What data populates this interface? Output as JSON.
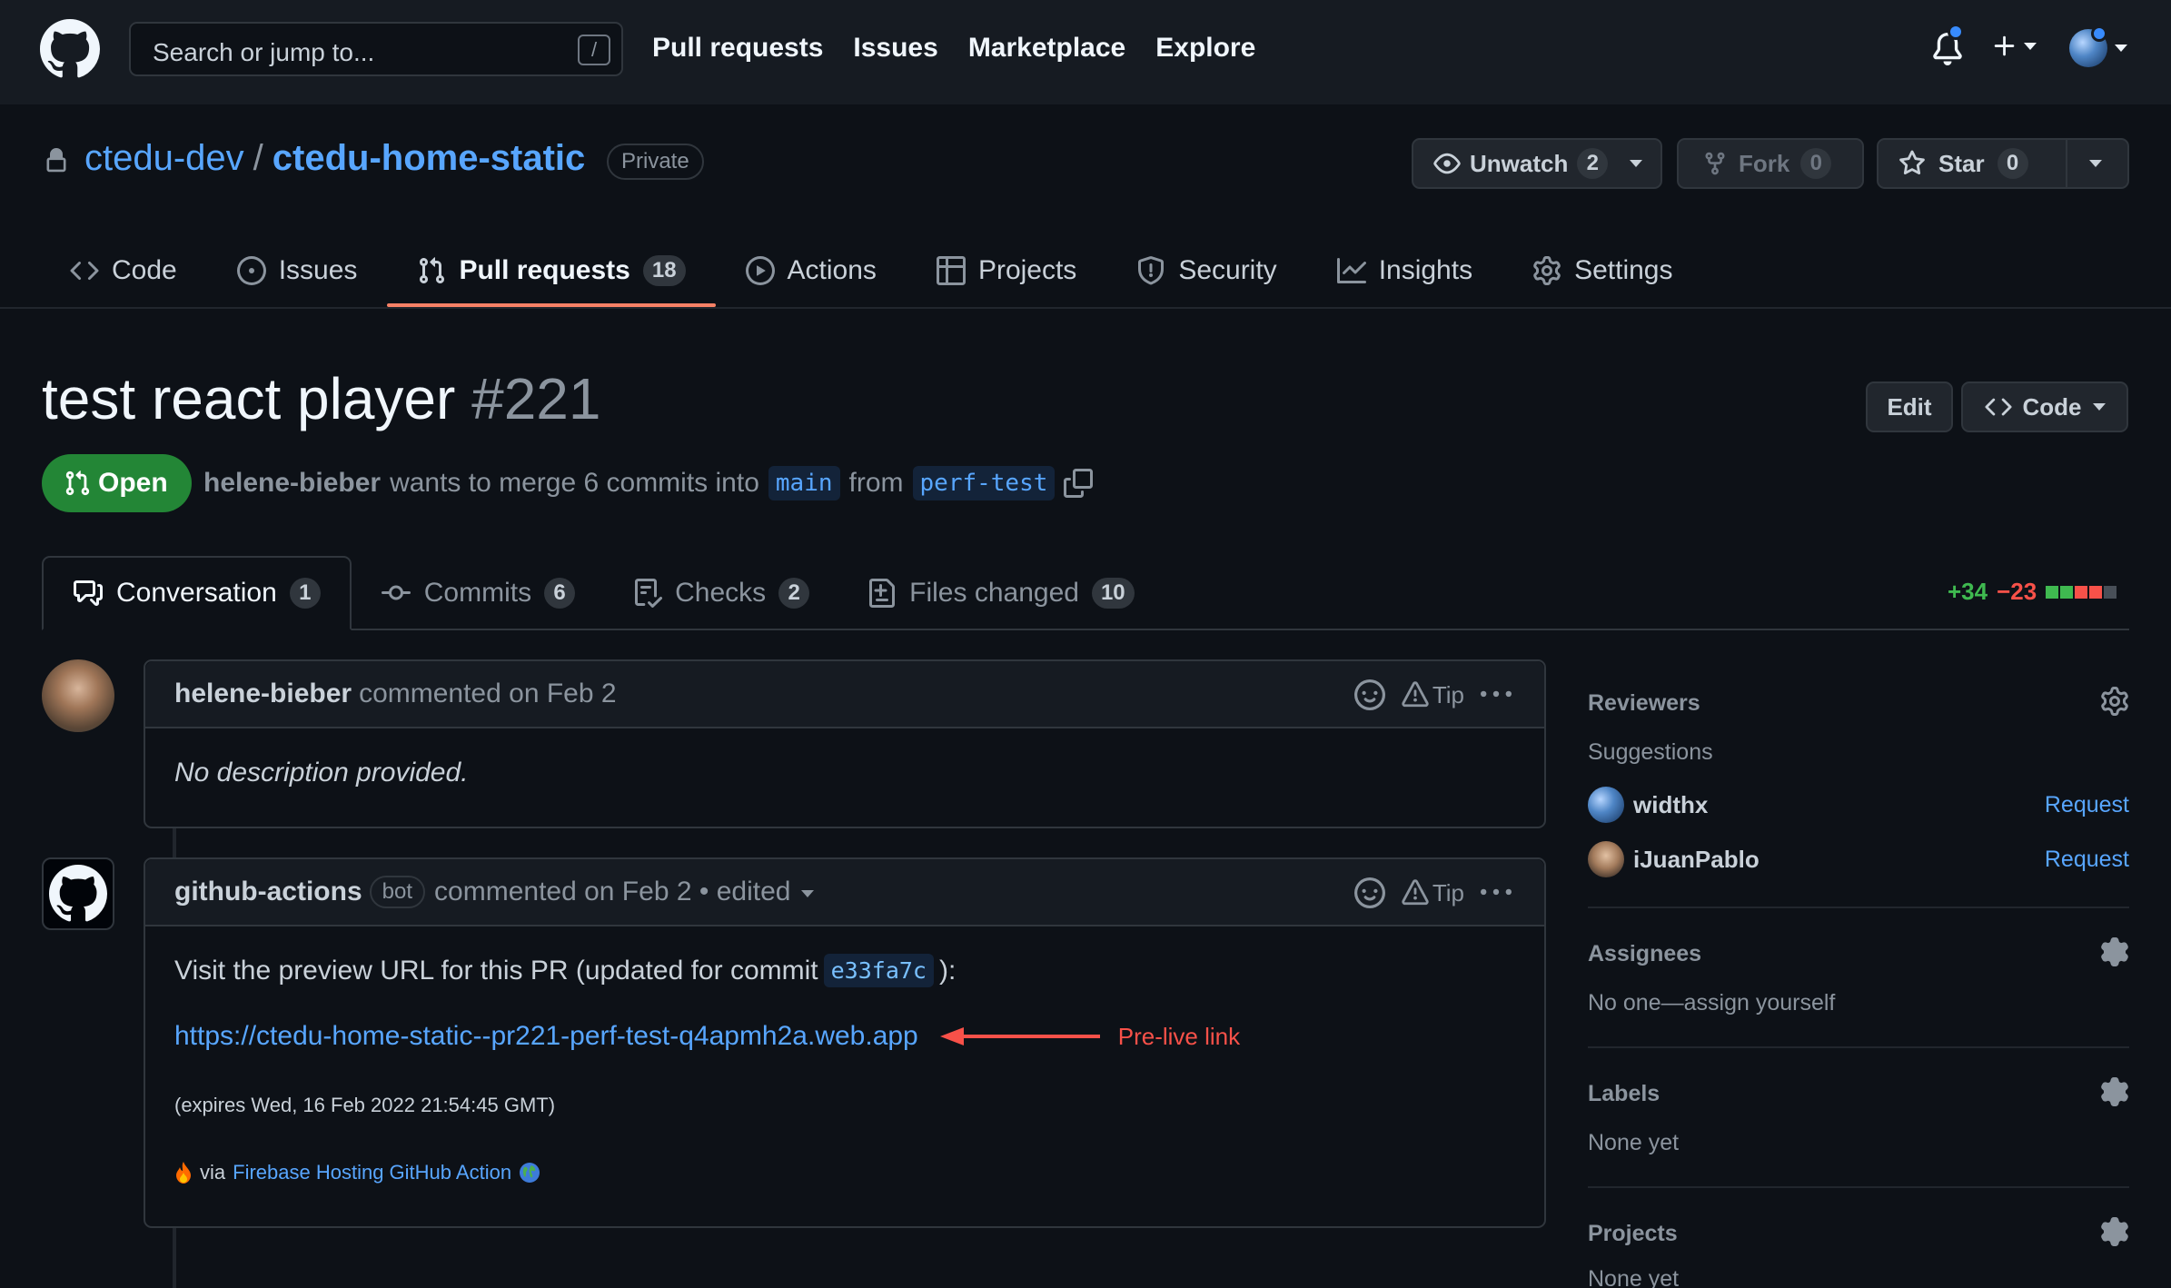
{
  "header": {
    "search_placeholder": "Search or jump to...",
    "search_shortcut": "/",
    "nav": [
      "Pull requests",
      "Issues",
      "Marketplace",
      "Explore"
    ]
  },
  "repo": {
    "owner": "ctedu-dev",
    "separator": "/",
    "name": "ctedu-home-static",
    "visibility": "Private",
    "unwatch_label": "Unwatch",
    "unwatch_count": "2",
    "fork_label": "Fork",
    "fork_count": "0",
    "star_label": "Star",
    "star_count": "0",
    "tabs": [
      {
        "label": "Code",
        "icon": "code-icon"
      },
      {
        "label": "Issues",
        "icon": "issue-icon"
      },
      {
        "label": "Pull requests",
        "icon": "pull-request-icon",
        "count": "18"
      },
      {
        "label": "Actions",
        "icon": "play-icon"
      },
      {
        "label": "Projects",
        "icon": "table-icon"
      },
      {
        "label": "Security",
        "icon": "shield-icon"
      },
      {
        "label": "Insights",
        "icon": "graph-icon"
      },
      {
        "label": "Settings",
        "icon": "gear-icon"
      }
    ]
  },
  "pr": {
    "title": "test react player",
    "number": "#221",
    "edit_label": "Edit",
    "code_label": "Code",
    "state": "Open",
    "author": "helene-bieber",
    "merge_text": "wants to merge 6 commits into",
    "base_branch": "main",
    "from_text": "from",
    "head_branch": "perf-test",
    "tabs": [
      {
        "label": "Conversation",
        "count": "1",
        "icon": "comment-discussion-icon"
      },
      {
        "label": "Commits",
        "count": "6",
        "icon": "commit-icon"
      },
      {
        "label": "Checks",
        "count": "2",
        "icon": "checklist-icon"
      },
      {
        "label": "Files changed",
        "count": "10",
        "icon": "file-diff-icon"
      }
    ],
    "additions": "+34",
    "deletions": "−23"
  },
  "comments": [
    {
      "author": "helene-bieber",
      "meta": "commented on Feb 2",
      "tip": "Tip",
      "body": "No description provided."
    },
    {
      "author": "github-actions",
      "bot_label": "bot",
      "meta": "commented on Feb 2 • edited",
      "tip": "Tip",
      "preview_text_before": "Visit the preview URL for this PR (updated for commit",
      "commit": "e33fa7c",
      "preview_text_after": "):",
      "url": "https://ctedu-home-static--pr221-perf-test-q4apmh2a.web.app",
      "annotation": "Pre-live link",
      "expires": "(expires Wed, 16 Feb 2022 21:54:45 GMT)",
      "via_prefix": "via",
      "via_link": "Firebase Hosting GitHub Action"
    }
  ],
  "sidebar": {
    "reviewers_title": "Reviewers",
    "suggestions_label": "Suggestions",
    "reviewers": [
      {
        "name": "widthx",
        "action": "Request"
      },
      {
        "name": "iJuanPablo",
        "action": "Request"
      }
    ],
    "assignees_title": "Assignees",
    "assignees_text": "No one—assign yourself",
    "labels_title": "Labels",
    "labels_text": "None yet",
    "projects_title": "Projects",
    "projects_text": "None yet"
  },
  "colors": {
    "accent_link": "#58a6ff",
    "open_green": "#238636",
    "tab_underline": "#f78166",
    "annotation_red": "#f85149"
  }
}
